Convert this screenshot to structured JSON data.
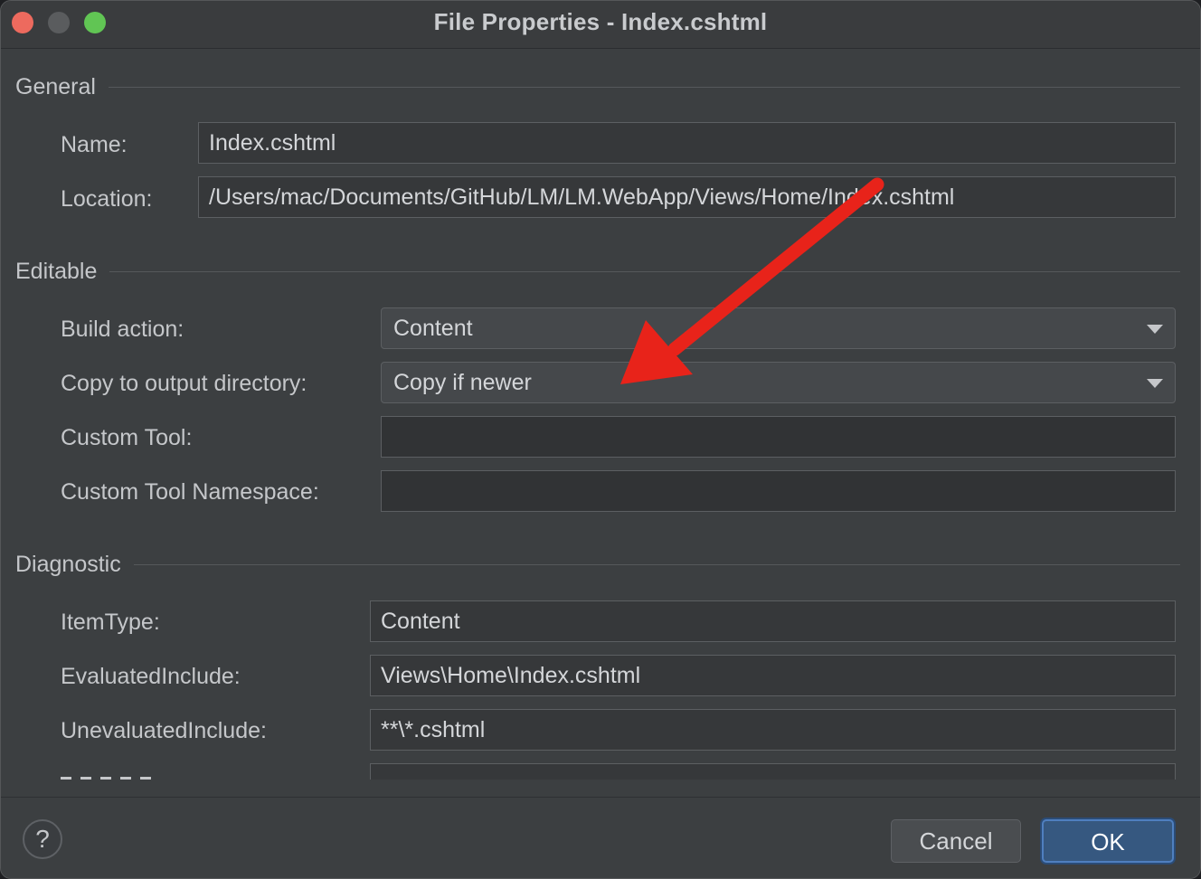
{
  "window": {
    "title": "File Properties - Index.cshtml"
  },
  "general": {
    "title": "General",
    "name_label": "Name:",
    "name_value": "Index.cshtml",
    "location_label": "Location:",
    "location_value": "/Users/mac/Documents/GitHub/LM/LM.WebApp/Views/Home/Index.cshtml"
  },
  "editable": {
    "title": "Editable",
    "build_action_label": "Build action:",
    "build_action_value": "Content",
    "copy_label": "Copy to output directory:",
    "copy_value": "Copy if newer",
    "custom_tool_label": "Custom Tool:",
    "custom_tool_value": "",
    "custom_ns_label": "Custom Tool Namespace:",
    "custom_ns_value": ""
  },
  "diagnostic": {
    "title": "Diagnostic",
    "itemtype_label": "ItemType:",
    "itemtype_value": "Content",
    "evaluated_label": "EvaluatedInclude:",
    "evaluated_value": "Views\\Home\\Index.cshtml",
    "unevaluated_label": "UnevaluatedInclude:",
    "unevaluated_value": "**\\*.cshtml"
  },
  "footer": {
    "help_label": "?",
    "cancel_label": "Cancel",
    "ok_label": "OK"
  },
  "colors": {
    "annotation_arrow": "#e8231a",
    "ok_button": "#365880",
    "window_bg": "#3c3f41"
  }
}
